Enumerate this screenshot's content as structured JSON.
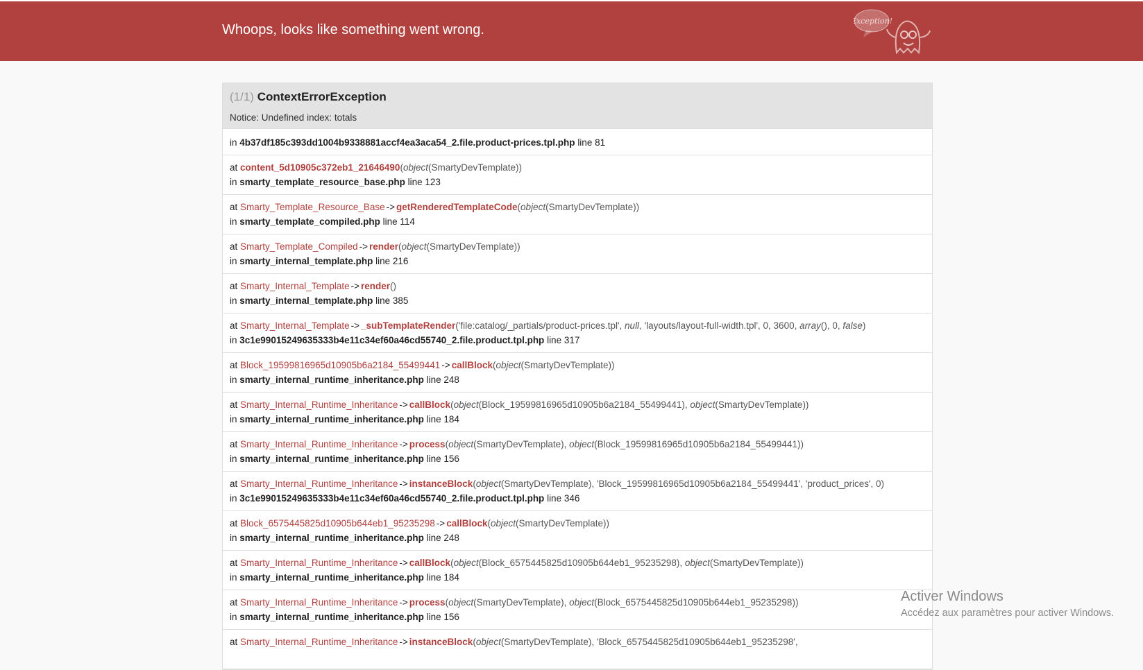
{
  "header": {
    "title": "Whoops, looks like something went wrong.",
    "logo_text": "Exception!"
  },
  "exception": {
    "count": "(1/1)",
    "name": "ContextErrorException",
    "message": "Notice: Undefined index: totals"
  },
  "first_location": {
    "prefix": "in",
    "file": "4b37df185c393dd1004b9338881accf4ea3aca54_2.file.product-prices.tpl.php",
    "line_label": "line 81"
  },
  "trace": [
    {
      "cls": "",
      "fn": "content_5d10905c372eb1_21646490",
      "args": "(object(SmartyDevTemplate))",
      "file": "smarty_template_resource_base.php",
      "line": "line 123"
    },
    {
      "cls": "Smarty_Template_Resource_Base",
      "fn": "getRenderedTemplateCode",
      "args": "(object(SmartyDevTemplate))",
      "file": "smarty_template_compiled.php",
      "line": "line 114"
    },
    {
      "cls": "Smarty_Template_Compiled",
      "fn": "render",
      "args": "(object(SmartyDevTemplate))",
      "file": "smarty_internal_template.php",
      "line": "line 216"
    },
    {
      "cls": "Smarty_Internal_Template",
      "fn": "render",
      "args": "()",
      "file": "smarty_internal_template.php",
      "line": "line 385"
    },
    {
      "cls": "Smarty_Internal_Template",
      "fn": "_subTemplateRender",
      "args": "('file:catalog/_partials/product-prices.tpl', null, 'layouts/layout-full-width.tpl', 0, 3600, array(), 0, false)",
      "file": "3c1e99015249635333b4e11c34ef60a46cd55740_2.file.product.tpl.php",
      "line": "line 317"
    },
    {
      "cls": "Block_19599816965d10905b6a2184_55499441",
      "fn": "callBlock",
      "args": "(object(SmartyDevTemplate))",
      "file": "smarty_internal_runtime_inheritance.php",
      "line": "line 248"
    },
    {
      "cls": "Smarty_Internal_Runtime_Inheritance",
      "fn": "callBlock",
      "args": "(object(Block_19599816965d10905b6a2184_55499441), object(SmartyDevTemplate))",
      "file": "smarty_internal_runtime_inheritance.php",
      "line": "line 184"
    },
    {
      "cls": "Smarty_Internal_Runtime_Inheritance",
      "fn": "process",
      "args": "(object(SmartyDevTemplate), object(Block_19599816965d10905b6a2184_55499441))",
      "file": "smarty_internal_runtime_inheritance.php",
      "line": "line 156"
    },
    {
      "cls": "Smarty_Internal_Runtime_Inheritance",
      "fn": "instanceBlock",
      "args": "(object(SmartyDevTemplate), 'Block_19599816965d10905b6a2184_55499441', 'product_prices', 0)",
      "file": "3c1e99015249635333b4e11c34ef60a46cd55740_2.file.product.tpl.php",
      "line": "line 346"
    },
    {
      "cls": "Block_6575445825d10905b644eb1_95235298",
      "fn": "callBlock",
      "args": "(object(SmartyDevTemplate))",
      "file": "smarty_internal_runtime_inheritance.php",
      "line": "line 248"
    },
    {
      "cls": "Smarty_Internal_Runtime_Inheritance",
      "fn": "callBlock",
      "args": "(object(Block_6575445825d10905b644eb1_95235298), object(SmartyDevTemplate))",
      "file": "smarty_internal_runtime_inheritance.php",
      "line": "line 184"
    },
    {
      "cls": "Smarty_Internal_Runtime_Inheritance",
      "fn": "process",
      "args": "(object(SmartyDevTemplate), object(Block_6575445825d10905b644eb1_95235298))",
      "file": "smarty_internal_runtime_inheritance.php",
      "line": "line 156"
    },
    {
      "cls": "Smarty_Internal_Runtime_Inheritance",
      "fn": "instanceBlock",
      "args": "(object(SmartyDevTemplate), 'Block_6575445825d10905b644eb1_95235298',",
      "file": "",
      "line": ""
    }
  ],
  "labels": {
    "at": "at",
    "in": "in",
    "arrow": "->"
  },
  "watermark": {
    "title": "Activer Windows",
    "subtitle": "Accédez aux paramètres pour activer Windows."
  },
  "colors": {
    "accent": "#b0413e",
    "panel_head": "#e3e3e3"
  }
}
